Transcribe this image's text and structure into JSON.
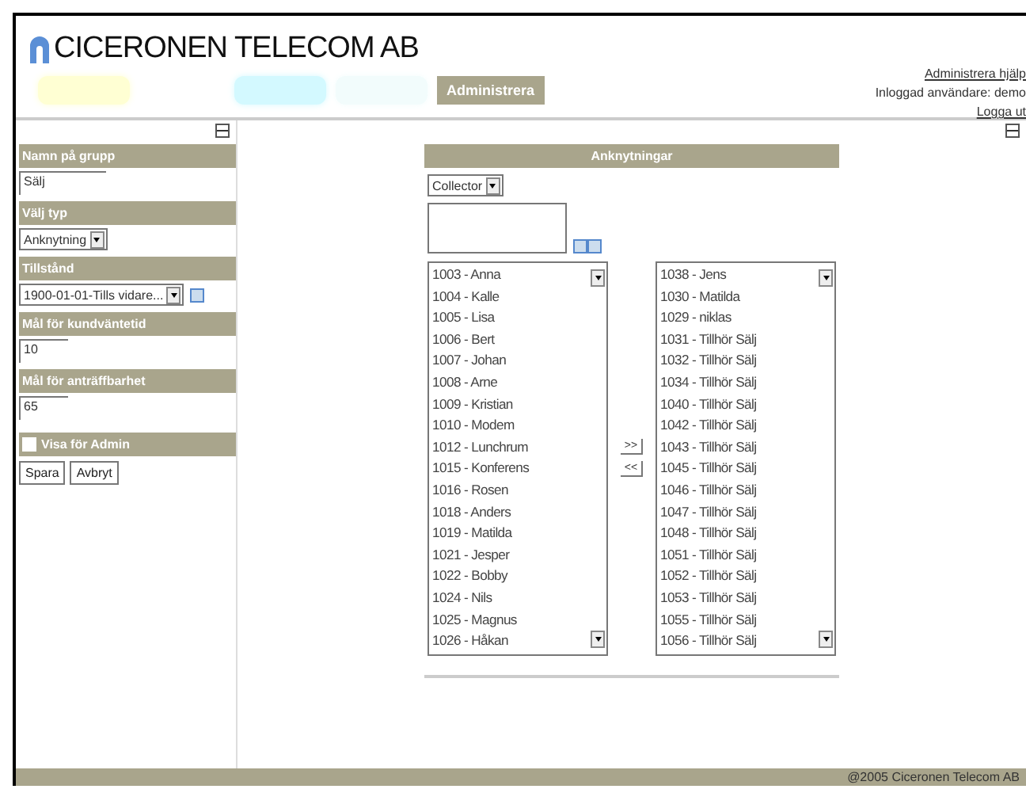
{
  "header": {
    "company": "CICERONEN TELECOM AB",
    "help_link": "Administrera hjälp",
    "user": "Inloggad användare: demo",
    "logout": "Logga ut"
  },
  "tabs": [
    {
      "color": "#ffffcc",
      "selected": false
    },
    {
      "color": "#ccf8ff",
      "selected": false
    },
    {
      "color": "#f0fcfc",
      "selected": false
    },
    {
      "label": "Administrera",
      "color": "#a9a58c",
      "selected": true
    }
  ],
  "sidebar": {
    "fields": [
      {
        "kind": "text",
        "label": "Namn på grupp",
        "value": "Sälj"
      },
      {
        "kind": "select",
        "label": "Välj typ",
        "value": "Anknytning"
      },
      {
        "kind": "select_add",
        "label": "Tillstånd",
        "value": "1900-01-01-Tills vidare..."
      },
      {
        "kind": "text",
        "label": "Mål för kundväntetid",
        "value": "10"
      },
      {
        "kind": "text",
        "label": "Mål för anträffbarhet",
        "value": "65"
      },
      {
        "kind": "checkbox",
        "label": "Visa för Admin",
        "checked": false
      }
    ],
    "buttons": [
      "Spara",
      "Avbryt"
    ]
  },
  "panel": {
    "title": "Anknytningar",
    "filter": "Collector",
    "available": [
      "1003 - Anna",
      "1004 - Kalle",
      "1005 - Lisa",
      "1006 - Bert",
      "1007 - Johan",
      "1008 - Arne",
      "1009 - Kristian",
      "1010 - Modem",
      "1012 - Lunchrum",
      "1015 - Konferens",
      "1016 - Rosen",
      "1018 - Anders",
      "1019 - Matilda",
      "1021 - Jesper",
      "1022 - Bobby",
      "1024 - Nils",
      "1025 - Magnus",
      "1026 - Håkan"
    ],
    "move_buttons": [
      ">>",
      "<<"
    ],
    "members": [
      "1038 - Jens",
      "1030 - Matilda",
      "1029 - niklas",
      "1031 - Tillhör Sälj",
      "1032 - Tillhör Sälj",
      "1034 - Tillhör Sälj",
      "1040 - Tillhör Sälj",
      "1042 - Tillhör Sälj",
      "1043 - Tillhör Sälj",
      "1045 - Tillhör Sälj",
      "1046 - Tillhör Sälj",
      "1047 - Tillhör Sälj",
      "1048 - Tillhör Sälj",
      "1051 - Tillhör Sälj",
      "1052 - Tillhör Sälj",
      "1053 - Tillhör Sälj",
      "1055 - Tillhör Sälj",
      "1056 - Tillhör Sälj"
    ]
  },
  "footer": "@2005 Ciceronen Telecom AB"
}
